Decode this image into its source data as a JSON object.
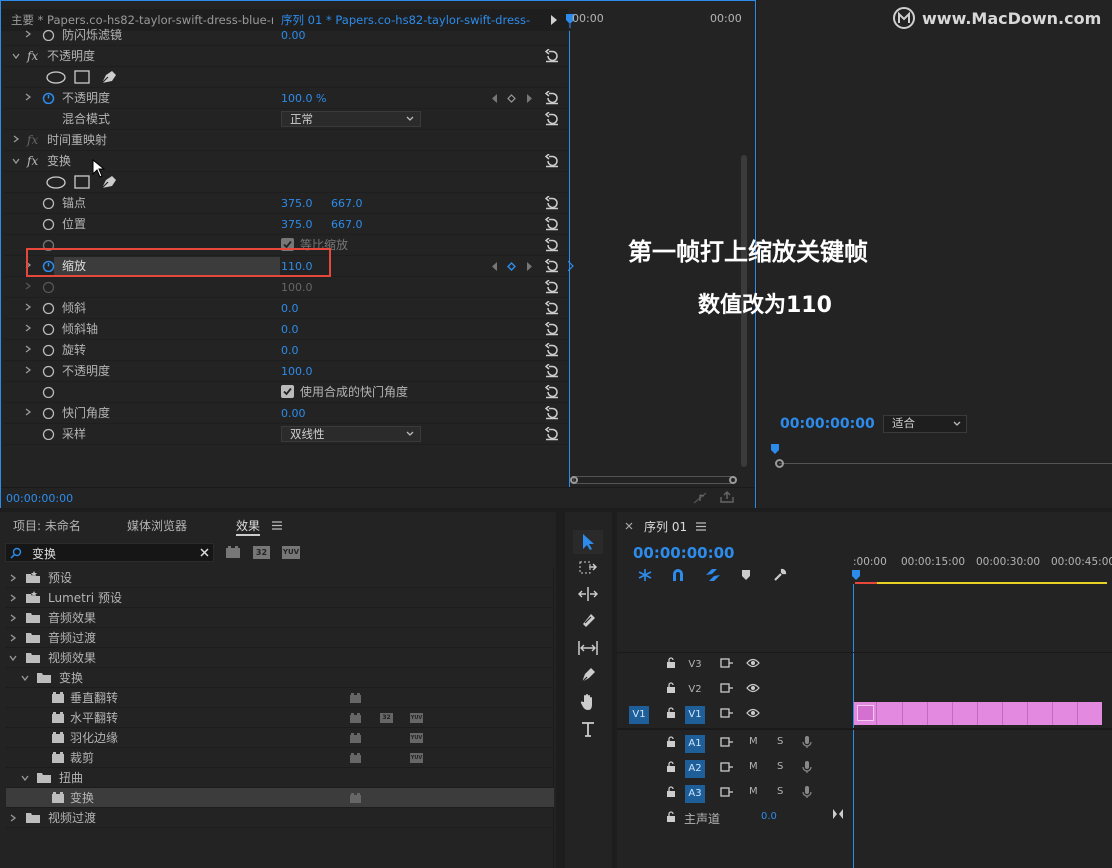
{
  "effect_controls": {
    "tab_master": "主要 * Papers.co-hs82-taylor-swift-dress-blue-mu...",
    "tab_sequence": "序列 01 * Papers.co-hs82-taylor-swift-dress-b...",
    "ruler_left": "00:00",
    "ruler_right": "00:00",
    "rows": {
      "r0": {
        "label": "防闪烁滤镜",
        "value": "0.00"
      },
      "r1": {
        "label": "不透明度"
      },
      "r3": {
        "label": "不透明度",
        "value": "100.0 %"
      },
      "r4": {
        "label": "混合模式",
        "select": "正常"
      },
      "r5": {
        "label": "时间重映射"
      },
      "r6": {
        "label": "变换"
      },
      "r8": {
        "label": "锚点",
        "v1": "375.0",
        "v2": "667.0"
      },
      "r9": {
        "label": "位置",
        "v1": "375.0",
        "v2": "667.0"
      },
      "r10": {
        "label": "等比缩放"
      },
      "r11": {
        "label": "缩放",
        "value": "110.0"
      },
      "r12": {
        "value": "100.0"
      },
      "r13": {
        "label": "倾斜",
        "value": "0.0"
      },
      "r14": {
        "label": "倾斜轴",
        "value": "0.0"
      },
      "r15": {
        "label": "旋转",
        "value": "0.0"
      },
      "r16": {
        "label": "不透明度",
        "value": "100.0"
      },
      "r17": {
        "label": "使用合成的快门角度"
      },
      "r18": {
        "label": "快门角度",
        "value": "0.00"
      },
      "r19": {
        "label": "采样",
        "select": "双线性"
      }
    },
    "footer_time": "00:00:00:00"
  },
  "overlay": {
    "watermark": "www.MacDown.com",
    "line1": "第一帧打上缩放关键帧",
    "line2": "数值改为110"
  },
  "program": {
    "timecode": "00:00:00:00",
    "fit": "适合"
  },
  "effects_panel": {
    "tabs": [
      "项目: 未命名",
      "媒体浏览器",
      "效果"
    ],
    "search": "变换",
    "badges": [
      "32",
      "YUV"
    ],
    "tree": [
      {
        "label": "预设"
      },
      {
        "label": "Lumetri 预设"
      },
      {
        "label": "音频效果"
      },
      {
        "label": "音频过渡"
      },
      {
        "label": "视频效果"
      },
      {
        "label": "变换"
      },
      {
        "label": "垂直翻转"
      },
      {
        "label": "水平翻转"
      },
      {
        "label": "羽化边缘"
      },
      {
        "label": "裁剪"
      },
      {
        "label": "扭曲"
      },
      {
        "label": "变换"
      },
      {
        "label": "视频过渡"
      }
    ]
  },
  "timeline": {
    "tab": "序列 01",
    "timecode": "00:00:00:00",
    "ruler": [
      ":00:00",
      "00:00:15:00",
      "00:00:30:00",
      "00:00:45:00"
    ],
    "tracks": {
      "v3": "V3",
      "v2": "V2",
      "v1_src": "V1",
      "v1": "V1",
      "a1": "A1",
      "a2": "A2",
      "a3": "A3",
      "m": "M",
      "s": "S",
      "master": "主声道",
      "master_val": "0.0"
    }
  },
  "colors": {
    "accent": "#2d8ceb",
    "highlight": "#e8483c",
    "clip": "#e38ae0",
    "workarea": "#e6d021"
  }
}
